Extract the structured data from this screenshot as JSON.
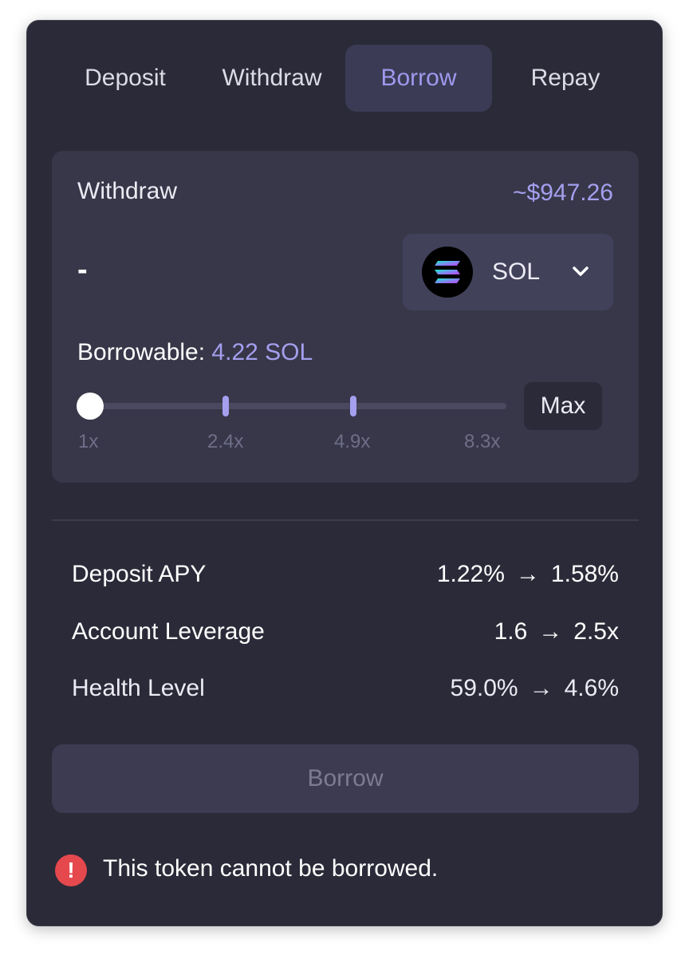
{
  "tabs": [
    {
      "label": "Deposit",
      "active": false
    },
    {
      "label": "Withdraw",
      "active": false
    },
    {
      "label": "Borrow",
      "active": true
    },
    {
      "label": "Repay",
      "active": false
    }
  ],
  "panel": {
    "label": "Withdraw",
    "usd_value": "~$947.26",
    "amount": "-",
    "token": {
      "symbol": "SOL",
      "icon": "solana-logo-icon"
    },
    "borrowable_label": "Borrowable:",
    "borrowable_value": "4.22 SOL",
    "leverage_ticks": [
      "1x",
      "2.4x",
      "4.9x",
      "8.3x"
    ],
    "slider_value_fraction": 0,
    "max_label": "Max"
  },
  "stats": [
    {
      "label": "Deposit APY",
      "from": "1.22%",
      "to": "1.58%"
    },
    {
      "label": "Account Leverage",
      "from": "1.6",
      "to": "2.5x"
    },
    {
      "label": "Health Level",
      "from": "59.0%",
      "to": "4.6%"
    }
  ],
  "arrow": "→",
  "borrow_button_label": "Borrow",
  "warning": {
    "icon": "exclamation-icon",
    "text": "This token cannot be borrowed."
  },
  "colors": {
    "background": "#2b2a38",
    "panel": "#383749",
    "accent": "#a49fee",
    "warning": "#e5484d"
  }
}
